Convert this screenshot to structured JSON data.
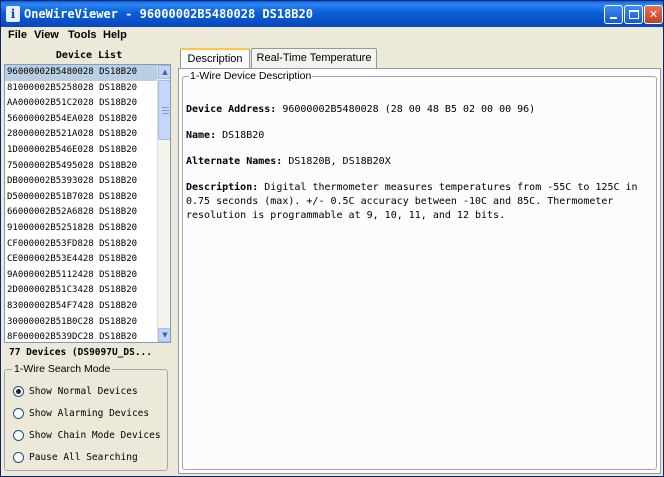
{
  "window": {
    "title": "OneWireViewer - 96000002B5480028 DS18B20",
    "icon_glyph": "i",
    "minimize_label": "",
    "maximize_label": "",
    "close_label": "✕"
  },
  "menu": [
    {
      "label": "File"
    },
    {
      "label": "View"
    },
    {
      "label": "Tools"
    },
    {
      "label": "Help"
    }
  ],
  "device_list": {
    "header": "Device List",
    "selected_index": 0,
    "items": [
      "96000002B5480028 DS18B20",
      "81000002B5258028 DS18B20",
      "AA000002B51C2028 DS18B20",
      "56000002B54EA028 DS18B20",
      "28000002B521A028 DS18B20",
      "1D000002B546E028 DS18B20",
      "75000002B5495028 DS18B20",
      "DB000002B5393028 DS18B20",
      "D5000002B51B7028 DS18B20",
      "66000002B52A6828 DS18B20",
      "91000002B5251828 DS18B20",
      "CF000002B53FD828 DS18B20",
      "CE000002B53E4428 DS18B20",
      "9A000002B5112428 DS18B20",
      "2D000002B51C3428 DS18B20",
      "83000002B54F7428 DS18B20",
      "30000002B51B0C28 DS18B20",
      "8F000002B539DC28 DS18B20"
    ],
    "scroll_up_glyph": "▲",
    "scroll_down_glyph": "▼",
    "count_text": "77 Devices  (DS9097U_DS..."
  },
  "search_mode": {
    "title": "1-Wire Search Mode",
    "options": [
      {
        "label": "Show Normal Devices",
        "selected": true
      },
      {
        "label": "Show Alarming Devices",
        "selected": false
      },
      {
        "label": "Show Chain Mode Devices",
        "selected": false
      },
      {
        "label": "Pause All Searching",
        "selected": false
      }
    ]
  },
  "tabs": [
    {
      "label": "Description",
      "active": true
    },
    {
      "label": "Real-Time Temperature",
      "active": false
    }
  ],
  "description": {
    "frame_title": "1-Wire Device Description",
    "address_label": "Device Address:",
    "address_value": "96000002B5480028 (28 00 48 B5 02 00 00 96)",
    "name_label": "Name:",
    "name_value": "DS18B20",
    "alt_names_label": "Alternate Names:",
    "alt_names_value": "DS1820B, DS18B20X",
    "desc_label": "Description:",
    "desc_value": "Digital thermometer measures temperatures from -55C to 125C in 0.75 seconds (max).  +/- 0.5C accuracy between -10C and 85C. Thermometer resolution is programmable at 9, 10, 11, and 12 bits."
  },
  "colors": {
    "titlebar": "#0a5fd8",
    "selection": "#b8cfe5",
    "tab_highlight": "#ffc83c"
  }
}
